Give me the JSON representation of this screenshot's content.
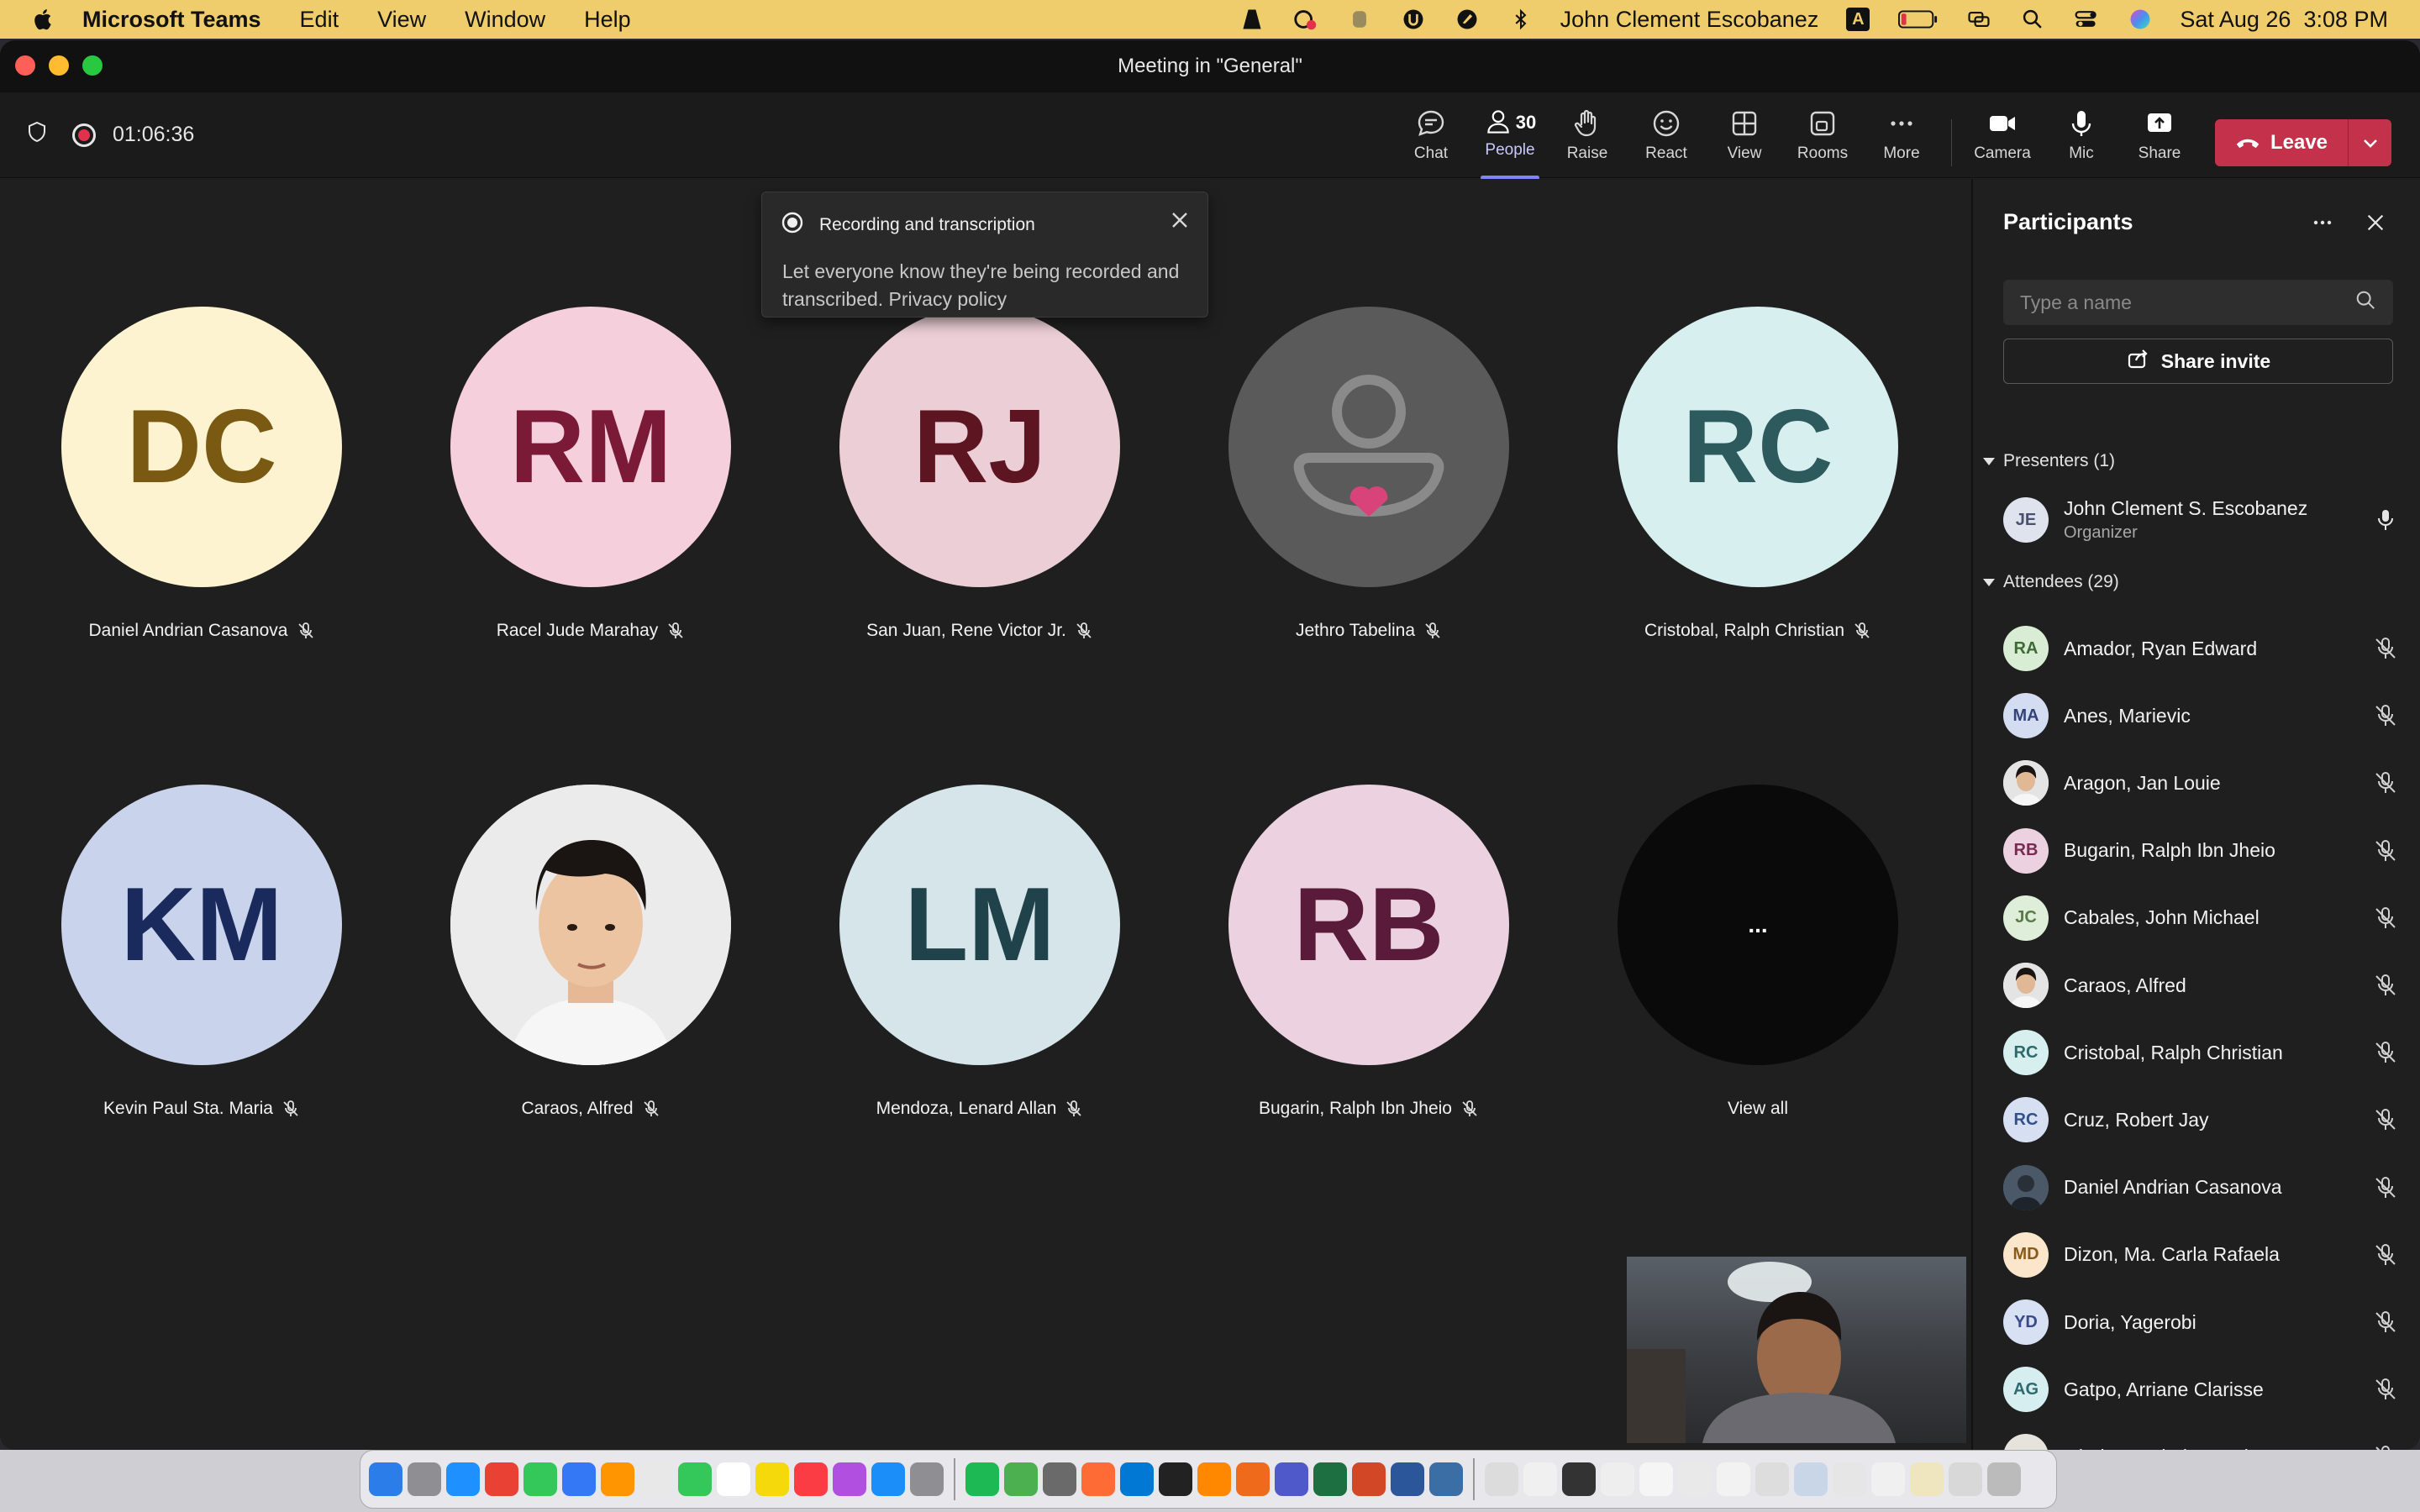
{
  "menubar": {
    "app_name": "Microsoft Teams",
    "menus": [
      "Edit",
      "View",
      "Window",
      "Help"
    ],
    "user_name": "John Clement Escobanez",
    "input_source": "A",
    "datetime": "Sat Aug 26  3:08 PM"
  },
  "window": {
    "title": "Meeting in \"General\""
  },
  "toolbar": {
    "timer": "01:06:36",
    "buttons": {
      "chat": "Chat",
      "people": "People",
      "people_count": "30",
      "raise": "Raise",
      "react": "React",
      "view": "View",
      "rooms": "Rooms",
      "more": "More",
      "camera": "Camera",
      "mic": "Mic",
      "share": "Share"
    },
    "leave": "Leave"
  },
  "toast": {
    "title": "Recording and transcription",
    "body": "Let everyone know they're being recorded and transcribed. Privacy policy"
  },
  "grid": {
    "tiles": [
      {
        "initials": "DC",
        "name": "Daniel Andrian Casanova",
        "bg": "#fdf3d0",
        "fg": "#7a5a12"
      },
      {
        "initials": "RM",
        "name": "Racel Jude Marahay",
        "bg": "#f5d0dc",
        "fg": "#7a1a36"
      },
      {
        "initials": "RJ",
        "name": "San Juan, Rene Victor Jr.",
        "bg": "#eccfd6",
        "fg": "#5e1522"
      },
      {
        "initials": "",
        "name": "Jethro Tabelina",
        "bg": "#5a5a5a",
        "fg": "#8a8a8a"
      },
      {
        "initials": "RC",
        "name": "Cristobal, Ralph Christian",
        "bg": "#d8eff0",
        "fg": "#2d5a5c"
      },
      {
        "initials": "KM",
        "name": "Kevin Paul Sta. Maria",
        "bg": "#c9d3ec",
        "fg": "#1a2a5c"
      },
      {
        "initials": "",
        "name": "Caraos, Alfred",
        "bg": "#e8e8e8",
        "fg": "#333333"
      },
      {
        "initials": "LM",
        "name": "Mendoza, Lenard Allan",
        "bg": "#d5e5ea",
        "fg": "#20424a"
      },
      {
        "initials": "RB",
        "name": "Bugarin, Ralph Ibn Jheio",
        "bg": "#ecd2e0",
        "fg": "#5a1a3a"
      },
      {
        "initials": "...",
        "name": "View all",
        "bg": "#0a0a0a",
        "fg": "#ffffff"
      }
    ]
  },
  "panel": {
    "title": "Participants",
    "search_placeholder": "Type a name",
    "share_invite": "Share invite",
    "presenters_label": "Presenters (1)",
    "attendees_label": "Attendees (29)",
    "presenters": [
      {
        "initials": "JE",
        "name": "John Clement S. Escobanez",
        "role": "Organizer",
        "bg": "#dfe3ee",
        "fg": "#4a5170"
      }
    ],
    "attendees": [
      {
        "initials": "RA",
        "name": "Amador, Ryan Edward",
        "bg": "#d9ecd4",
        "fg": "#3e6b34"
      },
      {
        "initials": "MA",
        "name": "Anes, Marievic",
        "bg": "#d4dcf2",
        "fg": "#34447a"
      },
      {
        "initials": "",
        "name": "Aragon, Jan Louie",
        "bg": "#f0f0f0",
        "fg": "#222222"
      },
      {
        "initials": "RB",
        "name": "Bugarin, Ralph Ibn Jheio",
        "bg": "#ecd2e0",
        "fg": "#7a2a52"
      },
      {
        "initials": "JC",
        "name": "Cabales, John Michael",
        "bg": "#dfeed8",
        "fg": "#5a7a48"
      },
      {
        "initials": "",
        "name": "Caraos, Alfred",
        "bg": "#e8e8e8",
        "fg": "#222222"
      },
      {
        "initials": "RC",
        "name": "Cristobal, Ralph Christian",
        "bg": "#d8eff0",
        "fg": "#2d6a6c"
      },
      {
        "initials": "RC",
        "name": "Cruz, Robert Jay",
        "bg": "#d6e0f2",
        "fg": "#34508a"
      },
      {
        "initials": "",
        "name": "Daniel Andrian Casanova",
        "bg": "#556070",
        "fg": "#ffffff"
      },
      {
        "initials": "MD",
        "name": "Dizon, Ma. Carla Rafaela",
        "bg": "#fbe6cc",
        "fg": "#8a5a1a"
      },
      {
        "initials": "YD",
        "name": "Doria, Yagerobi",
        "bg": "#d8e0f4",
        "fg": "#3a4a8a"
      },
      {
        "initials": "AG",
        "name": "Gatpo, Arriane Clarisse",
        "bg": "#d6eef0",
        "fg": "#2e6a70"
      },
      {
        "initials": "CG",
        "name": "Gloriane, Clarisse Lei",
        "bg": "#e6e2dc",
        "fg": "#6a5a4a"
      }
    ]
  },
  "colors": {
    "accent": "#7f85f5",
    "leave": "#c4314b",
    "recording": "#e0334b",
    "menubar": "#efcd6c"
  }
}
